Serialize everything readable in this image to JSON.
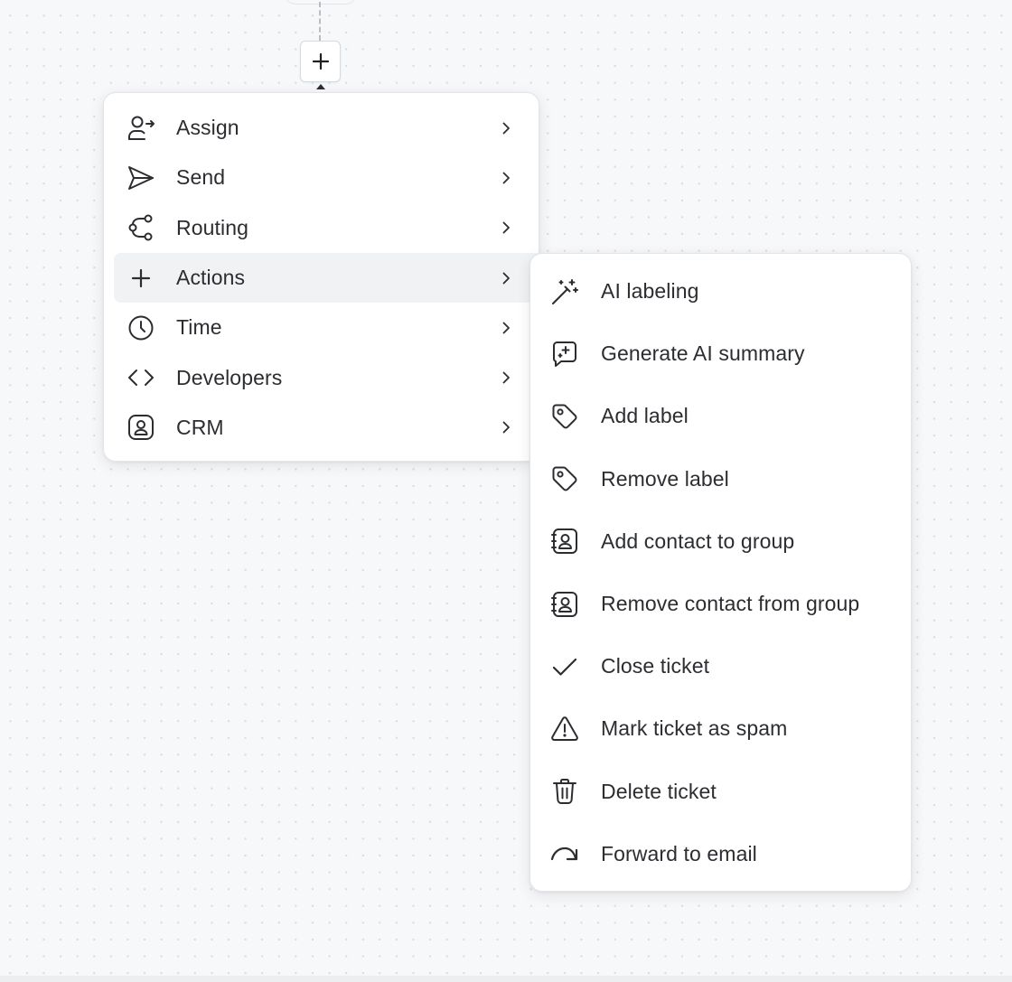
{
  "canvas": {
    "add_step_symbol": "+"
  },
  "main_menu": {
    "items": [
      {
        "label": "Assign",
        "icon": "user-arrow-icon"
      },
      {
        "label": "Send",
        "icon": "send-icon"
      },
      {
        "label": "Routing",
        "icon": "routing-icon"
      },
      {
        "label": "Actions",
        "icon": "plus-icon",
        "active": true
      },
      {
        "label": "Time",
        "icon": "clock-icon"
      },
      {
        "label": "Developers",
        "icon": "code-icon"
      },
      {
        "label": "CRM",
        "icon": "contact-card-icon"
      }
    ]
  },
  "actions_submenu": {
    "items": [
      {
        "label": "AI labeling",
        "icon": "magic-wand-icon"
      },
      {
        "label": "Generate AI summary",
        "icon": "ai-summary-icon"
      },
      {
        "label": "Add label",
        "icon": "tag-icon"
      },
      {
        "label": "Remove label",
        "icon": "tag-icon"
      },
      {
        "label": "Add contact to group",
        "icon": "contact-book-icon"
      },
      {
        "label": "Remove contact from group",
        "icon": "contact-book-icon"
      },
      {
        "label": "Close ticket",
        "icon": "check-icon"
      },
      {
        "label": "Mark ticket as spam",
        "icon": "warning-icon"
      },
      {
        "label": "Delete ticket",
        "icon": "trash-icon"
      },
      {
        "label": "Forward to email",
        "icon": "forward-arrow-icon"
      }
    ]
  },
  "colors": {
    "canvas_bg": "#f7f8f9",
    "menu_bg": "#ffffff",
    "active_item_bg": "#f1f2f4",
    "text": "#2b2d31"
  }
}
